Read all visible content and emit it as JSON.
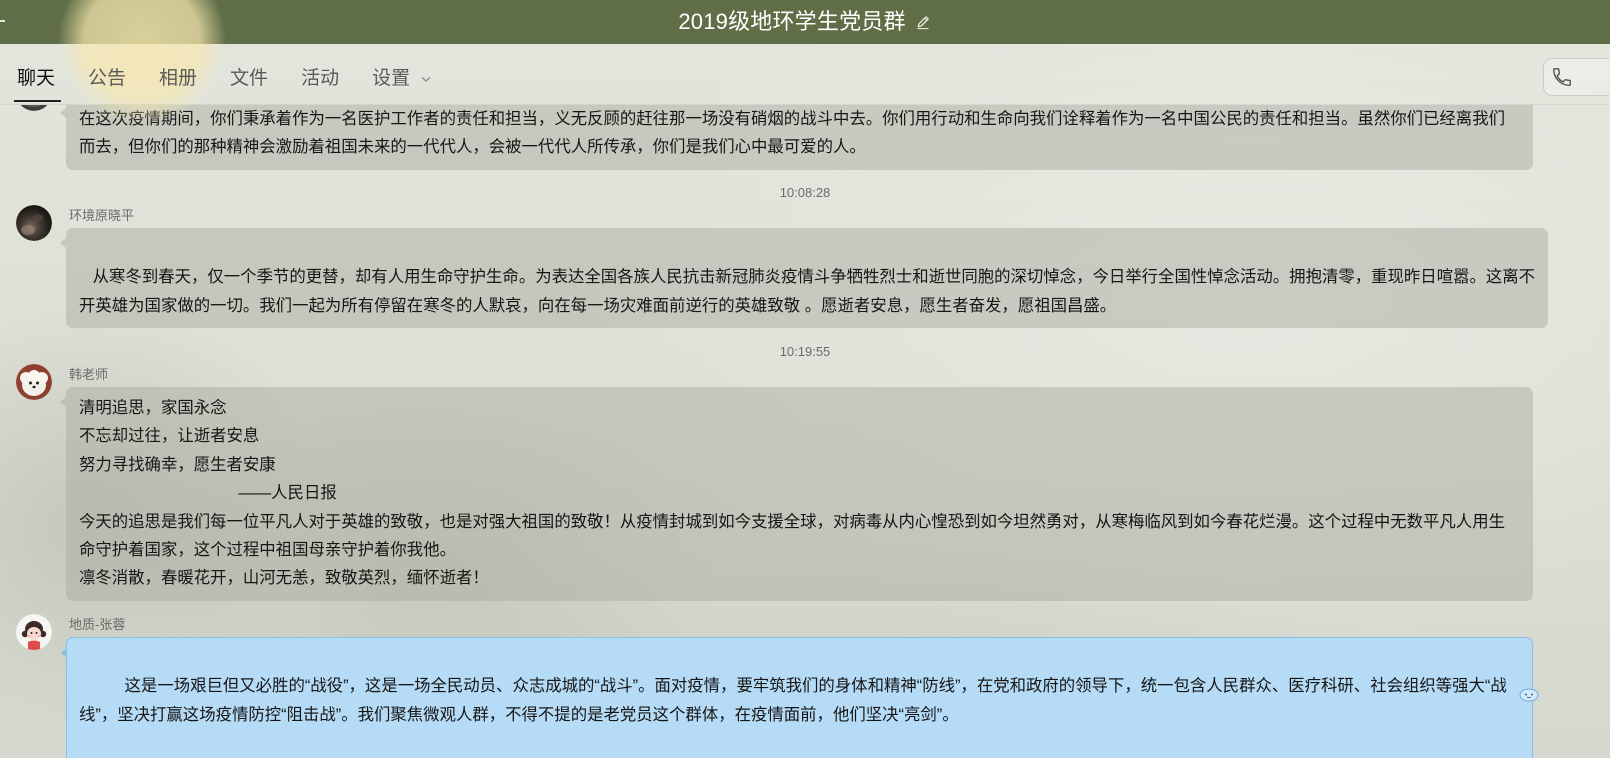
{
  "window": {
    "title": "2019级地环学生党员群"
  },
  "tabs": [
    {
      "label": "聊天",
      "active": true
    },
    {
      "label": "公告",
      "active": false
    },
    {
      "label": "相册",
      "active": false
    },
    {
      "label": "文件",
      "active": false
    },
    {
      "label": "活动",
      "active": false
    },
    {
      "label": "设置",
      "active": false,
      "has_dropdown": true
    }
  ],
  "icons": {
    "edit_title": "pencil-icon",
    "settings_dropdown": "chevron-down-icon",
    "call": "phone-icon",
    "bubble_decoration": "bubble-decoration-icon"
  },
  "colors": {
    "title_bar": "#5f6e46",
    "title_text": "#ffffff",
    "bubble": "#c8cac0",
    "highlight_bubble": "#b6dbf6",
    "highlight_bubble_border": "#86bfe8",
    "active_tab": "#111111",
    "inactive_tab": "#5a5a5a"
  },
  "chat": {
    "timestamps": [
      "10:08:28",
      "10:19:55"
    ],
    "messages": [
      {
        "text": "在这次疫情期间，你们秉承着作为一名医护工作者的责任和担当，义无反顾的赶往那一场没有硝烟的战斗中去。你们用行动和生命向我们诠释着作为一名中国公民的责任和担当。虽然你们已经离我们而去，但你们的那种精神会激励着祖国未来的一代代人，会被一代代人所传承，你们是我们心中最可爱的人。"
      },
      {
        "sender": "环境原晓平",
        "text": "\n   从寒冬到春天，仅一个季节的更替，却有人用生命守护生命。为表达全国各族人民抗击新冠肺炎疫情斗争牺牲烈士和逝世同胞的深切悼念，今日举行全国性悼念活动。拥抱清零，重现昨日喧嚣。这离不开英雄为国家做的一切。我们一起为所有停留在寒冬的人默哀，向在每一场灾难面前逆行的英雄致敬 。愿逝者安息，愿生者奋发，愿祖国昌盛。"
      },
      {
        "sender": "韩老师",
        "text": "清明追思，家国永念\n不忘却过往，让逝者安息\n努力寻找确幸，愿生者安康\n                                   ——人民日报\n今天的追思是我们每一位平凡人对于英雄的致敬，也是对强大祖国的致敬！从疫情封城到如今支援全球，对病毒从内心惶恐到如今坦然勇对，从寒梅临风到如今春花烂漫。这个过程中无数平凡人用生命守护着国家，这个过程中祖国母亲守护着你我他。\n凛冬消散，春暖花开，山河无恙，致敬英烈，缅怀逝者！"
      },
      {
        "sender": "地质-张蓉",
        "text": "这是一场艰巨但又必胜的“战役”，这是一场全民动员、众志成城的“战斗”。面对疫情，要牢筑我们的身体和精神“防线”，在党和政府的领导下，统一包含人民群众、医疗科研、社会组织等强大“战线”，坚决打赢这场疫情防控“阻击战”。我们聚焦微观人群，不得不提的是老党员这个群体，在疫情面前，他们坚决“亮剑”。"
      }
    ]
  }
}
